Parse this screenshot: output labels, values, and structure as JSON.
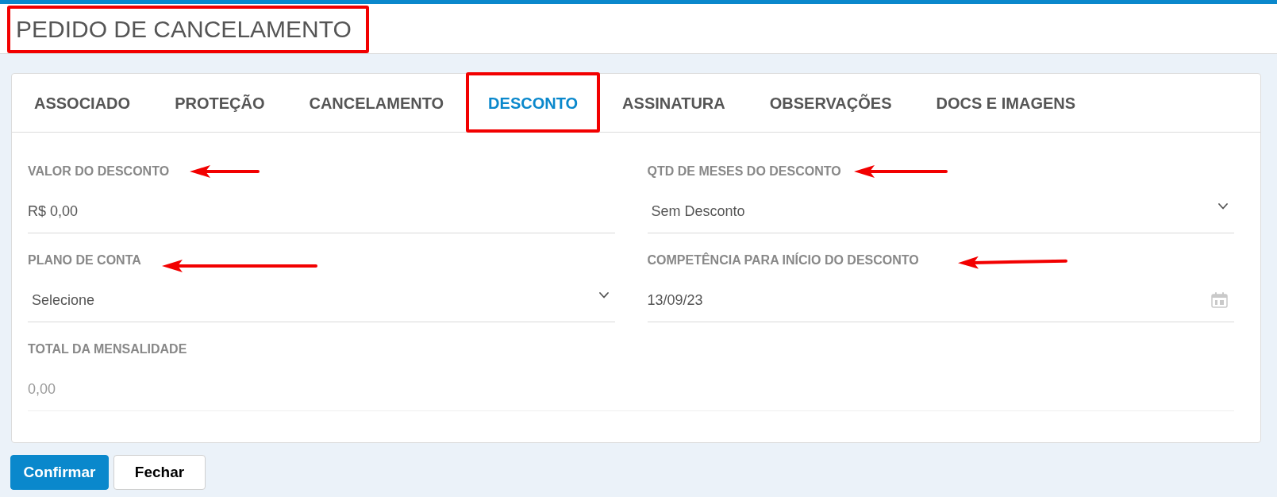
{
  "title": {
    "text": "PEDIDO DE CANCELAMENTO",
    "highlighted": true
  },
  "tabs": [
    {
      "label": "ASSOCIADO",
      "selected": false,
      "highlighted": false
    },
    {
      "label": "PROTEÇÃO",
      "selected": false,
      "highlighted": false
    },
    {
      "label": "CANCELAMENTO",
      "selected": false,
      "highlighted": false
    },
    {
      "label": "DESCONTO",
      "selected": true,
      "highlighted": true
    },
    {
      "label": "ASSINATURA",
      "selected": false,
      "highlighted": false
    },
    {
      "label": "OBSERVAÇÕES",
      "selected": false,
      "highlighted": false
    },
    {
      "label": "DOCS E IMAGENS",
      "selected": false,
      "highlighted": false
    }
  ],
  "fields": [
    {
      "kind": "text",
      "label": "VALOR DO DESCONTO",
      "value": "R$ 0,00",
      "arrow": true
    },
    {
      "kind": "select",
      "label": "QTD DE MESES DO DESCONTO",
      "value": "Sem Desconto",
      "arrow": true
    },
    {
      "kind": "select",
      "label": "PLANO DE CONTA",
      "value": "Selecione",
      "arrow": true
    },
    {
      "kind": "date",
      "label": "COMPETÊNCIA PARA INÍCIO DO DESCONTO",
      "value": "13/09/23",
      "arrow": true
    },
    {
      "kind": "readonly",
      "label": "TOTAL DA MENSALIDADE",
      "value": "0,00",
      "arrow": false
    }
  ],
  "buttons": [
    {
      "kind": "primary",
      "label": "Confirmar"
    },
    {
      "kind": "default",
      "label": "Fechar"
    }
  ]
}
